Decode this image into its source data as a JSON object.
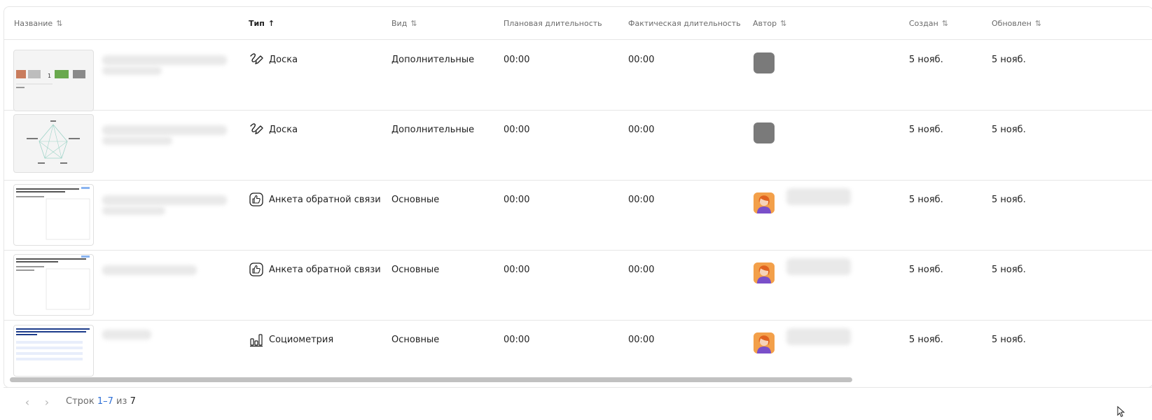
{
  "columns": [
    {
      "key": "name",
      "label": "Название",
      "sort": "both"
    },
    {
      "key": "type",
      "label": "Тип",
      "sort": "asc",
      "active": true
    },
    {
      "key": "kind",
      "label": "Вид",
      "sort": "both"
    },
    {
      "key": "planned",
      "label": "Плановая длительность",
      "sort": "none"
    },
    {
      "key": "actual",
      "label": "Фактическая длительность",
      "sort": "none"
    },
    {
      "key": "author",
      "label": "Автор",
      "sort": "both"
    },
    {
      "key": "created",
      "label": "Создан",
      "sort": "both"
    },
    {
      "key": "updated",
      "label": "Обновлен",
      "sort": "both"
    }
  ],
  "rows": [
    {
      "type_icon": "board-icon",
      "type": "Доска",
      "kind": "Дополнительные",
      "planned": "00:00",
      "actual": "00:00",
      "avatar": "gray-avatar",
      "created": "5 нояб.",
      "updated": "5 нояб."
    },
    {
      "type_icon": "board-icon",
      "type": "Доска",
      "kind": "Дополнительные",
      "planned": "00:00",
      "actual": "00:00",
      "avatar": "gray-avatar",
      "created": "5 нояб.",
      "updated": "5 нояб."
    },
    {
      "type_icon": "thumbs-up-icon",
      "type": "Анкета обратной связи",
      "kind": "Основные",
      "planned": "00:00",
      "actual": "00:00",
      "avatar": "person-avatar",
      "created": "5 нояб.",
      "updated": "5 нояб."
    },
    {
      "type_icon": "thumbs-up-icon",
      "type": "Анкета обратной связи",
      "kind": "Основные",
      "planned": "00:00",
      "actual": "00:00",
      "avatar": "person-avatar",
      "created": "5 нояб.",
      "updated": "5 нояб."
    },
    {
      "type_icon": "bar-chart-icon",
      "type": "Социометрия",
      "kind": "Основные",
      "planned": "00:00",
      "actual": "00:00",
      "avatar": "person-avatar",
      "created": "5 нояб.",
      "updated": "5 нояб."
    }
  ],
  "pagination": {
    "rows_label": "Строк",
    "range": "1–7",
    "of_label": "из",
    "total": "7"
  },
  "colors": {
    "accent": "#2d6fd6",
    "border": "#e6e6e6",
    "avatar_gray": "#7a7a7a",
    "avatar_orange": "#f3a04a"
  }
}
